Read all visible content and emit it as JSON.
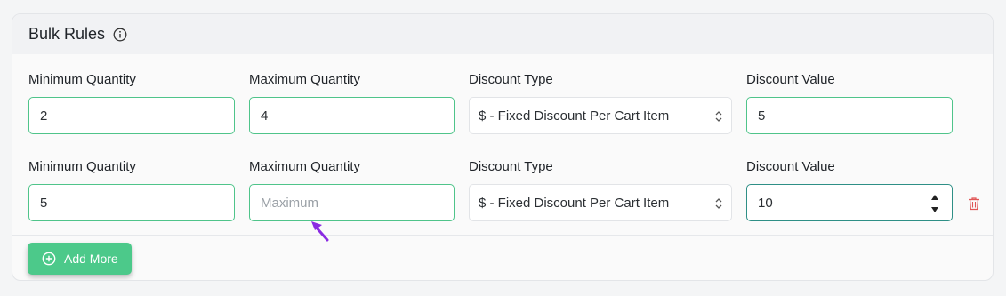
{
  "section": {
    "title": "Bulk Rules",
    "info_icon": "info-circle-icon"
  },
  "rules": [
    {
      "min_label": "Minimum Quantity",
      "min_value": "2",
      "max_label": "Maximum Quantity",
      "max_value": "4",
      "max_placeholder": "",
      "type_label": "Discount Type",
      "type_value": "$ - Fixed Discount Per Cart Item",
      "value_label": "Discount Value",
      "value_value": "5"
    },
    {
      "min_label": "Minimum Quantity",
      "min_value": "5",
      "max_label": "Maximum Quantity",
      "max_value": "",
      "max_placeholder": "Maximum",
      "type_label": "Discount Type",
      "type_value": "$ - Fixed Discount Per Cart Item",
      "value_label": "Discount Value",
      "value_value": "10"
    }
  ],
  "actions": {
    "add_more_label": "Add More",
    "delete_icon": "trash-icon"
  },
  "colors": {
    "accent_green": "#4cc98a",
    "input_border": "#4fc48a",
    "focus_border": "#2e8f86",
    "delete_red": "#e05555",
    "cursor_purple": "#8a2be2"
  }
}
